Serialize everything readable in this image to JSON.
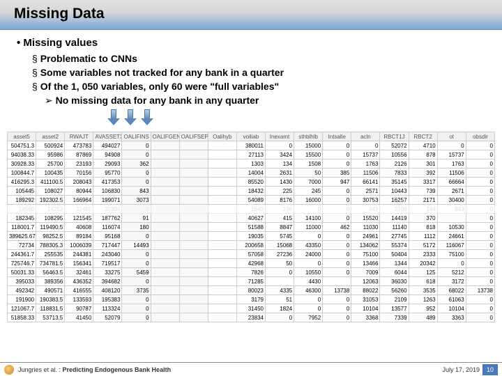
{
  "title": "Missing Data",
  "bullets": {
    "main": "Missing values",
    "sub1": "Problematic to CNNs",
    "sub2": "Some variables not tracked for any bank in a quarter",
    "sub3": "Of the 1, 050 variables, only 60 were \"full variables\"",
    "arrow": "No missing data for any bank in any quarter"
  },
  "headers": [
    "asset5",
    "asset2",
    "RWAJT",
    "AVASSET3",
    "OALIFINS",
    "OALIFGEN",
    "OALIFSEP",
    "Oalihyb",
    "voiliab",
    "Inexamt",
    "sthblhlb",
    "Intsalle",
    "acln",
    "RBCT1J",
    "RBCT2",
    "ot",
    "obsdir"
  ],
  "rows": [
    [
      "504751.3",
      "500924",
      "473783",
      "494027",
      "0",
      "",
      "",
      "",
      "380011",
      "0",
      "15000",
      "0",
      "0",
      "52072",
      "4710",
      "0",
      "0"
    ],
    [
      "94038.33",
      "95986",
      "87869",
      "94908",
      "0",
      "",
      "",
      "",
      "27113",
      "3424",
      "15500",
      "0",
      "15737",
      "10556",
      "878",
      "15737",
      "0"
    ],
    [
      "30928.33",
      "25700",
      "23193",
      "29093",
      "362",
      "",
      "",
      "",
      "1303",
      "134",
      "1508",
      "0",
      "1763",
      "2126",
      "301",
      "1763",
      "0"
    ],
    [
      "100844.7",
      "100435",
      "70156",
      "95770",
      "0",
      "",
      "",
      "",
      "14004",
      "2631",
      "50",
      "385",
      "11506",
      "7833",
      "392",
      "11506",
      "0"
    ],
    [
      "416295.3",
      "411100.5",
      "208043",
      "417353",
      "0",
      "",
      "",
      "",
      "85520",
      "1430",
      "7000",
      "947",
      "66141",
      "35145",
      "3317",
      "66664",
      "0"
    ],
    [
      "105445",
      "108027",
      "80944",
      "106830",
      "843",
      "",
      "",
      "",
      "18432",
      "225",
      "245",
      "0",
      "2571",
      "10443",
      "739",
      "2671",
      "0"
    ],
    [
      "189292",
      "192302.5",
      "166964",
      "199071",
      "3073",
      "",
      "",
      "",
      "54089",
      "8176",
      "16000",
      "0",
      "30753",
      "16257",
      "2171",
      "30400",
      "0"
    ],
    [
      "14560",
      "14253",
      "11455",
      "20304",
      "0",
      "",
      "",
      "",
      "1640",
      "136",
      "0",
      "0",
      "443",
      "2106",
      "144",
      "843",
      "0"
    ],
    [
      "182345",
      "108295",
      "121545",
      "187762",
      "91",
      "",
      "",
      "",
      "40627",
      "415",
      "14100",
      "0",
      "15520",
      "14419",
      "370",
      "",
      "0"
    ],
    [
      "118001.7",
      "119490.5",
      "40608",
      "116074",
      "180",
      "",
      "",
      "",
      "51588",
      "8847",
      "11000",
      "462",
      "11030",
      "11140",
      "818",
      "10530",
      "0"
    ],
    [
      "389625.67",
      "98252.5",
      "89184",
      "95168",
      "0",
      "",
      "",
      "",
      "19035",
      "5745",
      "0",
      "0",
      "24961",
      "27745",
      "1112",
      "24661",
      "0"
    ],
    [
      "72734",
      "788305.3",
      "1006039",
      "717447",
      "14493",
      "",
      "",
      "",
      "200658",
      "15068",
      "43350",
      "0",
      "134062",
      "55374",
      "5172",
      "116067",
      "0"
    ],
    [
      "244361.7",
      "255535",
      "244381",
      "243040",
      "0",
      "",
      "",
      "",
      "57058",
      "27236",
      "24000",
      "0",
      "75100",
      "50404",
      "2333",
      "75100",
      "0"
    ],
    [
      "725746.7",
      "734781.5",
      "156341",
      "719517",
      "0",
      "",
      "",
      "",
      "42968",
      "50",
      "0",
      "0",
      "13466",
      "1344",
      "20342",
      "0",
      "0"
    ],
    [
      "50031.33",
      "56463.5",
      "32461",
      "33275",
      "5459",
      "",
      "",
      "",
      "7826",
      "0",
      "10550",
      "0",
      "7009",
      "6044",
      "125",
      "5212",
      "0"
    ],
    [
      "395033",
      "389356",
      "436352",
      "394682",
      "0",
      "",
      "",
      "",
      "71285",
      "",
      "4430",
      "",
      "12063",
      "36030",
      "618",
      "3172",
      "0"
    ],
    [
      "492342",
      "490571",
      "416555",
      "408120",
      "3735",
      "",
      "",
      "",
      "80023",
      "4335",
      "46300",
      "13738",
      "88022",
      "56260",
      "3535",
      "68022",
      "13738"
    ],
    [
      "191900",
      "190383.5",
      "133593",
      "195383",
      "0",
      "",
      "",
      "",
      "3179",
      "51",
      "0",
      "0",
      "31053",
      "2109",
      "1263",
      "61063",
      "0"
    ],
    [
      "121067.7",
      "118831.5",
      "90787",
      "113324",
      "0",
      "",
      "",
      "",
      "31450",
      "1824",
      "0",
      "0",
      "10104",
      "13577",
      "952",
      "10104",
      "0"
    ],
    [
      "51858.33",
      "53713.5",
      "41450",
      "52079",
      "0",
      "",
      "",
      "",
      "23834",
      "0",
      "7952",
      "0",
      "3368",
      "7339",
      "489",
      "3363",
      "0"
    ]
  ],
  "footer": {
    "author": "Jungries et al. : ",
    "title": "Predicting Endogenous Bank Health",
    "date": "July 17, 2019",
    "page": "10"
  }
}
